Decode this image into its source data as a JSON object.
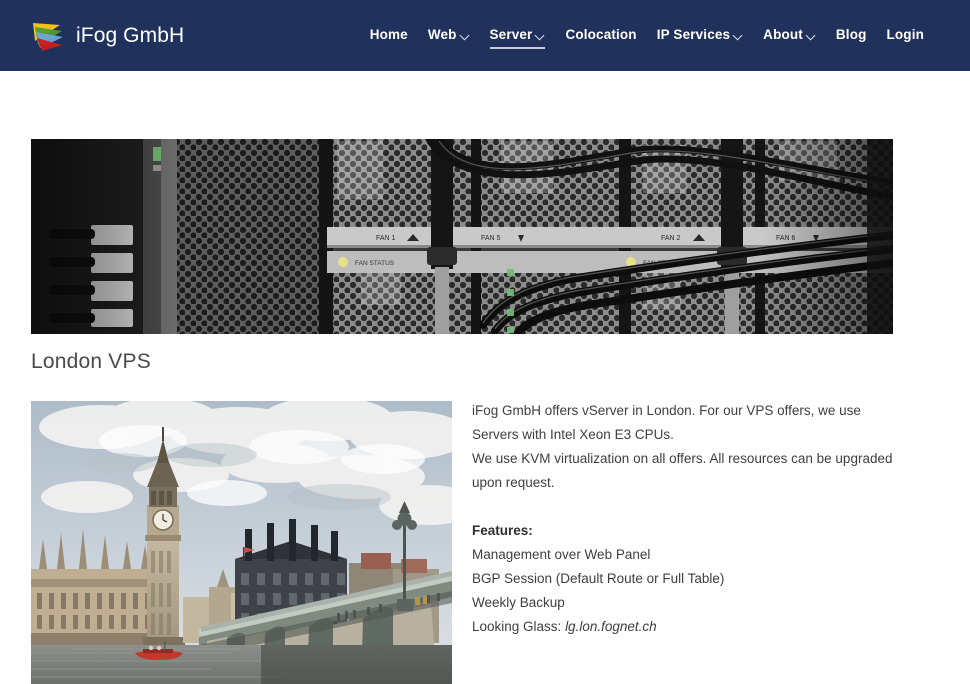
{
  "header": {
    "brand": {
      "name": "iFog GmbH",
      "logo_icon": "ifog-triangles-logo",
      "logo_colors": [
        "#f2c21a",
        "#4f9c37",
        "#6fa8d6",
        "#cf1a1a"
      ]
    },
    "background_color": "#20325c",
    "nav": [
      {
        "label": "Home",
        "has_dropdown": false,
        "active": false,
        "caret_icon": ""
      },
      {
        "label": "Web",
        "has_dropdown": true,
        "active": false,
        "caret_icon": "chevron-down-icon"
      },
      {
        "label": "Server",
        "has_dropdown": true,
        "active": true,
        "caret_icon": "chevron-down-icon"
      },
      {
        "label": "Colocation",
        "has_dropdown": false,
        "active": false,
        "caret_icon": ""
      },
      {
        "label": "IP Services",
        "has_dropdown": true,
        "active": false,
        "caret_icon": "chevron-down-icon"
      },
      {
        "label": "About",
        "has_dropdown": true,
        "active": false,
        "caret_icon": "chevron-down-icon"
      },
      {
        "label": "Blog",
        "has_dropdown": false,
        "active": false,
        "caret_icon": ""
      },
      {
        "label": "Login",
        "has_dropdown": false,
        "active": false,
        "caret_icon": ""
      }
    ]
  },
  "main": {
    "banner_image": {
      "alt": "Grayscale close-up of server chassis with perforated fan panels and cabling",
      "labels": [
        "FAN 1",
        "FAN 5",
        "FAN 2",
        "FAN 6",
        "FAN STATUS",
        "FAN STATUS"
      ]
    },
    "page_title": "London VPS",
    "city_image": {
      "alt": "Big Ben, the Houses of Parliament and Westminster Bridge over the River Thames in London"
    },
    "paragraphs": [
      "iFog GmbH offers vServer in London. For our VPS offers, we use Servers with Intel Xeon E3 CPUs.",
      "We use KVM virtualization on all offers. All resources can be upgraded upon request."
    ],
    "features_title": "Features:",
    "features": [
      {
        "text": "Management over Web Panel",
        "emphasis": ""
      },
      {
        "text": "BGP Session (Default Route or Full Table)",
        "emphasis": ""
      },
      {
        "text": "Weekly Backup",
        "emphasis": ""
      },
      {
        "text": "Looking Glass: ",
        "emphasis": "lg.lon.fognet.ch"
      }
    ]
  },
  "colors": {
    "header_navy": "#20325c",
    "body_text": "#3f3f3f",
    "title_text": "#4a4a4a",
    "page_background": "#ffffff"
  }
}
